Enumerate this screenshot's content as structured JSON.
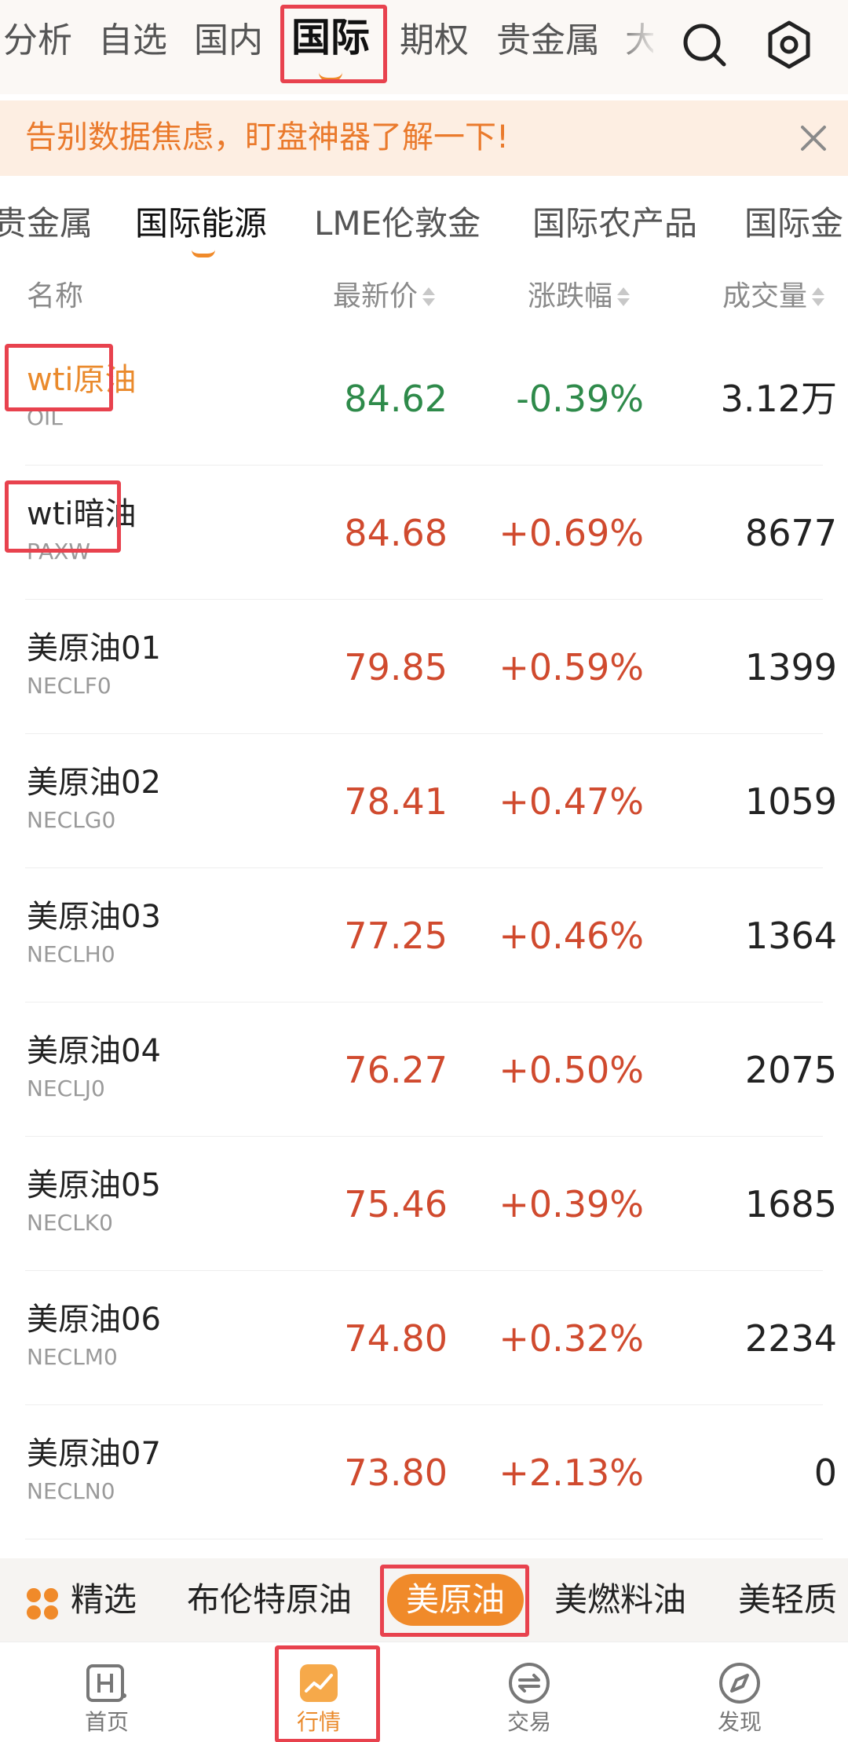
{
  "topnav": {
    "tabs": [
      {
        "label": "分析",
        "visible_label": "分析"
      },
      {
        "label": "自选"
      },
      {
        "label": "国内"
      },
      {
        "label": "国际"
      },
      {
        "label": "期权"
      },
      {
        "label": "贵金属"
      },
      {
        "label": "大"
      }
    ],
    "active_index": 3,
    "icons": [
      "search-icon",
      "settings-hex-icon"
    ]
  },
  "banner": {
    "text": "告别数据焦虑，盯盘神器了解一下!",
    "close_icon": "close-icon"
  },
  "subtabs": {
    "items": [
      "贵金属",
      "国际能源",
      "LME伦敦金",
      "国际农产品",
      "国际金"
    ],
    "active_index": 1
  },
  "table": {
    "headers": {
      "name": "名称",
      "price": "最新价",
      "change": "涨跌幅",
      "volume": "成交量"
    },
    "rows": [
      {
        "name": "wti原油",
        "code": "OIL",
        "price": "84.62",
        "change": "-0.39%",
        "volume": "3.12万",
        "direction": "down",
        "highlight": true
      },
      {
        "name": "wti暗油",
        "code": "PAXW",
        "price": "84.68",
        "change": "+0.69%",
        "volume": "8677",
        "direction": "up",
        "highlight": false
      },
      {
        "name": "美原油01",
        "code": "NECLF0",
        "price": "79.85",
        "change": "+0.59%",
        "volume": "1399",
        "direction": "up",
        "highlight": false
      },
      {
        "name": "美原油02",
        "code": "NECLG0",
        "price": "78.41",
        "change": "+0.47%",
        "volume": "1059",
        "direction": "up",
        "highlight": false
      },
      {
        "name": "美原油03",
        "code": "NECLH0",
        "price": "77.25",
        "change": "+0.46%",
        "volume": "1364",
        "direction": "up",
        "highlight": false
      },
      {
        "name": "美原油04",
        "code": "NECLJ0",
        "price": "76.27",
        "change": "+0.50%",
        "volume": "2075",
        "direction": "up",
        "highlight": false
      },
      {
        "name": "美原油05",
        "code": "NECLK0",
        "price": "75.46",
        "change": "+0.39%",
        "volume": "1685",
        "direction": "up",
        "highlight": false
      },
      {
        "name": "美原油06",
        "code": "NECLM0",
        "price": "74.80",
        "change": "+0.32%",
        "volume": "2234",
        "direction": "up",
        "highlight": false
      },
      {
        "name": "美原油07",
        "code": "NECLN0",
        "price": "73.80",
        "change": "+2.13%",
        "volume": "0",
        "direction": "up",
        "highlight": false
      }
    ]
  },
  "chips": {
    "items": [
      "精选",
      "布伦特原油",
      "美原油",
      "美燃料油",
      "美轻质"
    ],
    "active_index": 2
  },
  "bottomnav": {
    "items": [
      {
        "label": "首页",
        "icon": "home-h-icon"
      },
      {
        "label": "行情",
        "icon": "market-chart-icon"
      },
      {
        "label": "交易",
        "icon": "trade-exchange-icon"
      },
      {
        "label": "发现",
        "icon": "discover-compass-icon"
      }
    ],
    "active_index": 1
  },
  "colors": {
    "accent": "#f08a2a",
    "up": "#d04a2e",
    "down": "#2e8a4a",
    "annotation": "#e8424e"
  }
}
